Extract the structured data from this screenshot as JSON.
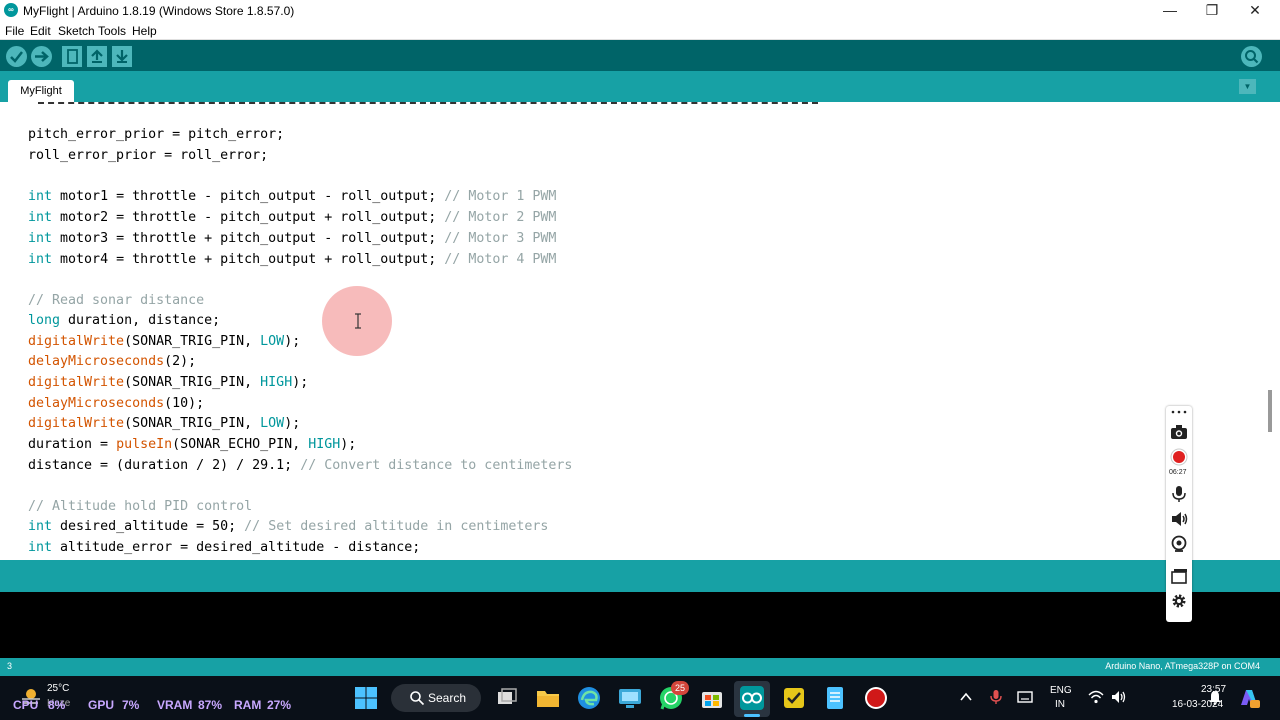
{
  "window": {
    "title": "MyFlight | Arduino 1.8.19 (Windows Store 1.8.57.0)",
    "icon_text": "∞",
    "minimize": "—",
    "maximize": "❐",
    "close": "✕"
  },
  "menu": [
    "File",
    "Edit",
    "Sketch",
    "Tools",
    "Help"
  ],
  "toolbar": {
    "buttons": [
      "verify-icon",
      "upload-icon",
      "new-icon",
      "open-icon",
      "save-icon"
    ],
    "serial_monitor": "serial-monitor-icon",
    "accent": "#4DB7BB",
    "background": "#006468"
  },
  "tabs": {
    "active": "MyFlight",
    "menu": "▼"
  },
  "code": [
    "pitch_error_prior = pitch_error;",
    "roll_error_prior = roll_error;",
    "",
    "int motor1 = throttle - pitch_output - roll_output; // Motor 1 PWM",
    "int motor2 = throttle - pitch_output + roll_output; // Motor 2 PWM",
    "int motor3 = throttle + pitch_output - roll_output; // Motor 3 PWM",
    "int motor4 = throttle + pitch_output + roll_output; // Motor 4 PWM",
    "",
    "// Read sonar distance",
    "long duration, distance;",
    "digitalWrite(SONAR_TRIG_PIN, LOW);",
    "delayMicroseconds(2);",
    "digitalWrite(SONAR_TRIG_PIN, HIGH);",
    "delayMicroseconds(10);",
    "digitalWrite(SONAR_TRIG_PIN, LOW);",
    "duration = pulseIn(SONAR_ECHO_PIN, HIGH);",
    "distance = (duration / 2) / 29.1; // Convert distance to centimeters",
    "",
    "// Altitude hold PID control",
    "int desired_altitude = 50; // Set desired altitude in centimeters",
    "int altitude_error = desired_altitude - distance;"
  ],
  "status": {
    "line": "3",
    "board": "Arduino Nano, ATmega328P on COM4"
  },
  "recorder": {
    "time": "06:27"
  },
  "taskbar": {
    "cpu_label": "CPU",
    "cpu_value": "8%",
    "gpu_label": "GPU",
    "gpu_value": "7%",
    "vram_label": "VRAM",
    "vram_value": "87%",
    "ram_label": "RAM",
    "ram_value": "27%",
    "weather_temp": "25°C",
    "weather_cond": "Haze",
    "search": "Search",
    "whatsapp_badge": "25",
    "lang_line1": "ENG",
    "lang_line2": "IN",
    "time": "23:57",
    "date": "16-03-2024"
  }
}
